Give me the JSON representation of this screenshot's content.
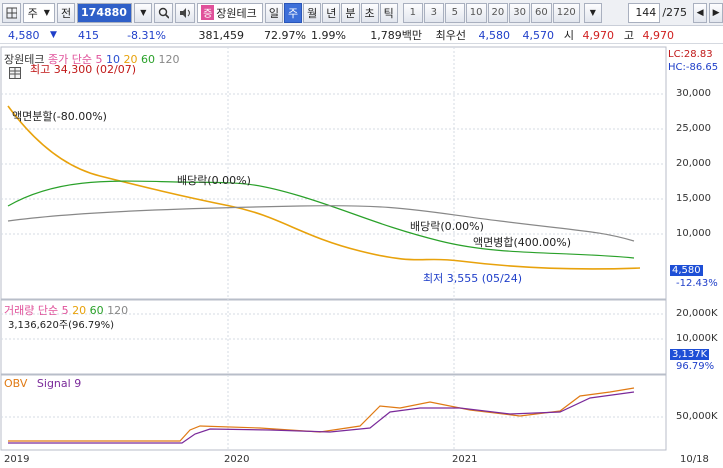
{
  "toolbar": {
    "menu_label": "주",
    "jeon_label": "전",
    "stock_code": "174880",
    "badge": "증",
    "stock_name": "장원테크",
    "period_tabs": [
      "일",
      "주",
      "월",
      "년",
      "분",
      "초",
      "틱"
    ],
    "active_period": "주",
    "number_buttons": [
      "1",
      "3",
      "5",
      "10",
      "20",
      "30",
      "60",
      "120"
    ],
    "count_value": "144",
    "count_total": "/275"
  },
  "quote": {
    "price": "4,580",
    "change": "415",
    "change_pct": "-8.31%",
    "volume": "381,459",
    "vol_ratio": "72.97%",
    "turnover": "1.99%",
    "amount": "1,789백만",
    "status": "최우선",
    "bid": "4,580",
    "ask": "4,570",
    "open_label": "시",
    "open": "4,970",
    "high_label": "고",
    "high": "4,970"
  },
  "price_pane": {
    "title": "장원테크",
    "ma_label": "종가 단순",
    "ma_periods": [
      "5",
      "10",
      "20",
      "60",
      "120"
    ],
    "high_note": "최고 34,300 (02/07)",
    "low_note": "최저 3,555 (05/24)",
    "annotations": [
      "액면분할(-80.00%)",
      "배당락(0.00%)",
      "배당락(0.00%)",
      "액면병합(400.00%)"
    ],
    "lc": "LC:28.83",
    "hc": "HC:-86.65",
    "y_axis": [
      "30,000",
      "25,000",
      "20,000",
      "15,000",
      "10,000"
    ],
    "current_price": "4,580",
    "current_pct": "-12.43%"
  },
  "volume_pane": {
    "title": "거래량",
    "ma_label": "단순",
    "ma_periods": [
      "5",
      "20",
      "60",
      "120"
    ],
    "max_note": "3,136,620주(96.79%)",
    "y_axis": [
      "20,000K",
      "10,000K"
    ],
    "current": "3,137K",
    "current_pct": "96.79%"
  },
  "obv_pane": {
    "title": "OBV",
    "signal": "Signal 9",
    "y_axis": [
      "50,000K"
    ]
  },
  "x_axis": [
    "2019",
    "2020",
    "2021",
    "10/18"
  ],
  "colors": {
    "up": "#e0281e",
    "down": "#1e4fd6",
    "ma5": "#e0519a",
    "ma10": "#2a4fd0",
    "ma20": "#e8a20c",
    "ma60": "#2aa12a",
    "ma120": "#888888",
    "obv": "#e07a14",
    "signal": "#7a2a9a"
  }
}
